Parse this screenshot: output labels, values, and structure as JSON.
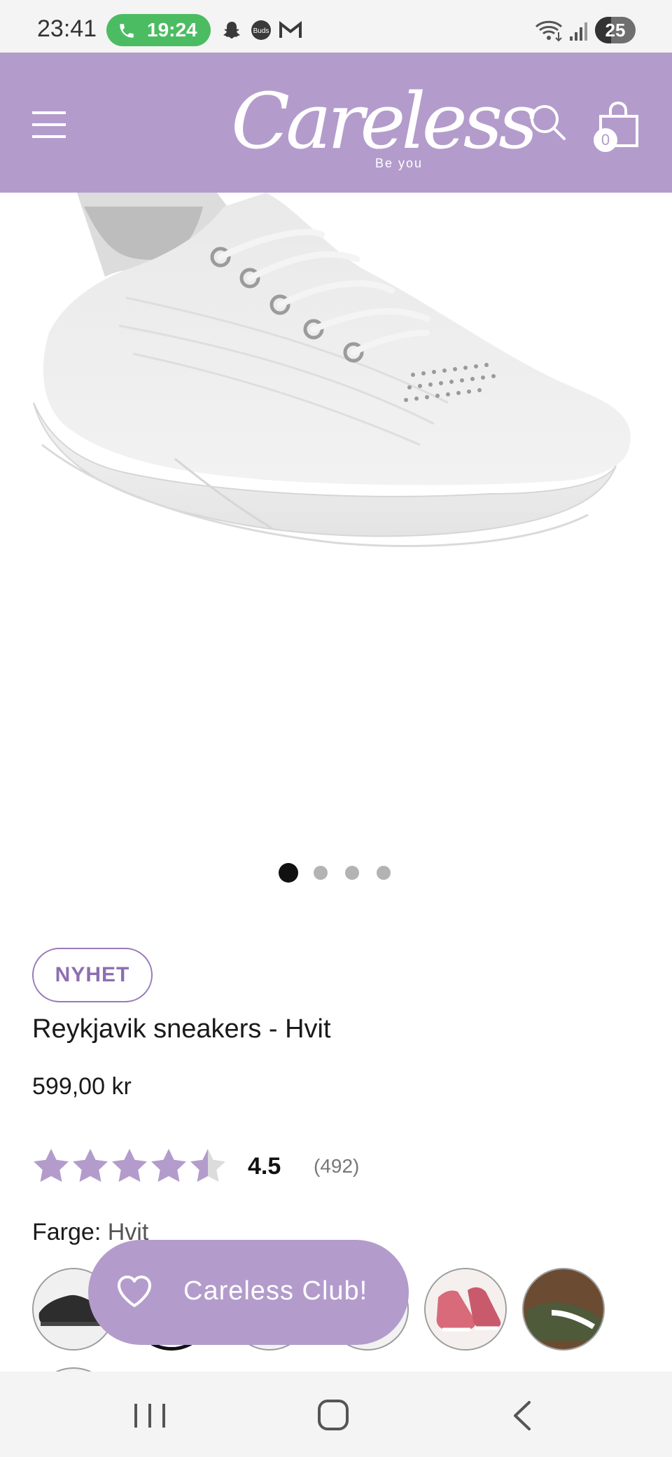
{
  "status_bar": {
    "time": "23:41",
    "call_duration": "19:24",
    "battery": "25",
    "notification_icons": [
      "snapchat-icon",
      "buds-icon",
      "gmail-icon"
    ],
    "system_icons": [
      "wifi-icon",
      "signal-icon",
      "battery-icon"
    ]
  },
  "header": {
    "logo_text": "Careless",
    "logo_tagline": "Be you",
    "cart_count": "0",
    "icons": [
      "menu-icon",
      "search-icon",
      "shopping-bag-icon"
    ],
    "background_color": "#b39ccc"
  },
  "gallery": {
    "total_images": 4,
    "active_index": 0,
    "image_description_icon": "white-sneaker-image"
  },
  "product": {
    "badge": "NYHET",
    "title": "Reykjavik sneakers - Hvit",
    "price": "599,00 kr",
    "rating": {
      "value": "4.5",
      "count": "(492)",
      "stars_filled": 4.5,
      "stars_total": 5,
      "star_color": "#b39ccc"
    },
    "color": {
      "label": "Farge:",
      "value": "Hvit"
    },
    "swatches": [
      "black",
      "white",
      "white",
      "white",
      "pink",
      "olive"
    ]
  },
  "club_button": {
    "label": "Careless Club!",
    "icon": "heart-icon"
  },
  "nav_bar": {
    "buttons": [
      "recents-icon",
      "home-icon",
      "back-icon"
    ]
  }
}
